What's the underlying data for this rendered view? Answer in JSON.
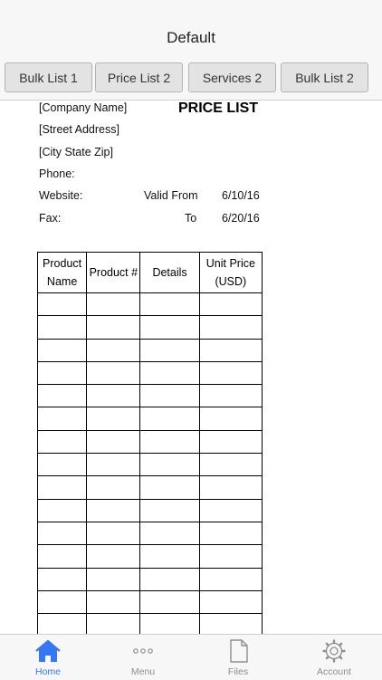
{
  "navbar": {
    "title": "Default"
  },
  "tabs": [
    {
      "label": "Bulk List 1"
    },
    {
      "label": "Price List 2"
    },
    {
      "label": "Services 2"
    },
    {
      "label": "Bulk List 2"
    }
  ],
  "sheet": {
    "company": "[Company Name]",
    "title": "PRICE LIST",
    "street": "[Street Address]",
    "city": "[City State Zip]",
    "phone_label": "Phone:",
    "website_label": "Website:",
    "fax_label": "Fax:",
    "valid_from_label": "Valid From",
    "valid_from_value": "6/10/16",
    "to_label": "To",
    "to_value": "6/20/16",
    "table": {
      "headers": [
        {
          "line1": "Product",
          "line2": "Name"
        },
        {
          "line1": "Product #",
          "line2": ""
        },
        {
          "line1": "Details",
          "line2": ""
        },
        {
          "line1": "Unit Price",
          "line2": "(USD)"
        }
      ],
      "row_count": 15
    }
  },
  "tabbar": {
    "items": [
      {
        "label": "Home",
        "icon": "home-icon",
        "active": true
      },
      {
        "label": "Menu",
        "icon": "ellipsis-icon",
        "active": false
      },
      {
        "label": "Files",
        "icon": "file-icon",
        "active": false
      },
      {
        "label": "Account",
        "icon": "gear-icon",
        "active": false
      }
    ],
    "active_color": "#3478f6",
    "inactive_color": "#8e8e93"
  }
}
